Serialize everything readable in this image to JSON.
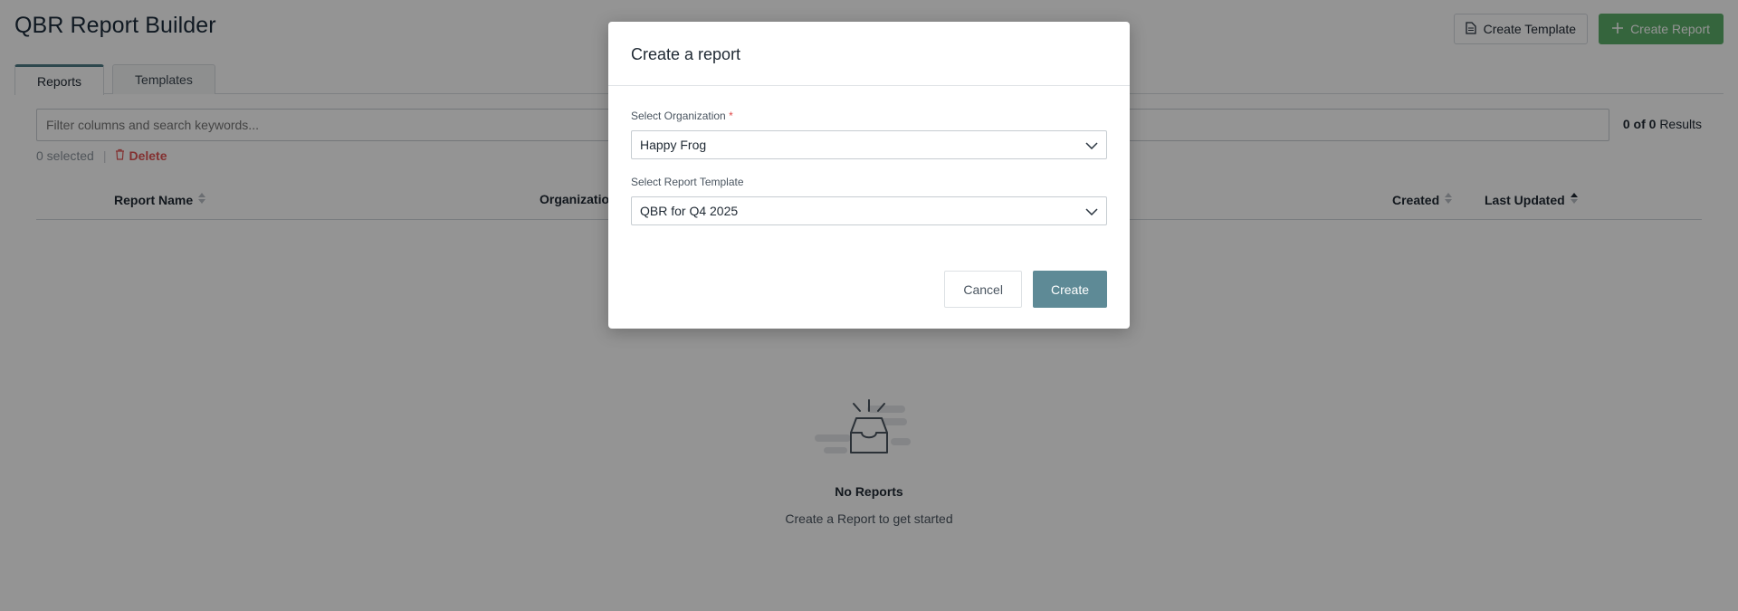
{
  "header": {
    "title": "QBR Report Builder",
    "create_template_label": "Create Template",
    "create_report_label": "Create Report",
    "create_report_icon": "plus-icon",
    "create_template_icon": "document-icon"
  },
  "tabs": [
    {
      "label": "Reports",
      "active": true
    },
    {
      "label": "Templates",
      "active": false
    }
  ],
  "search": {
    "placeholder": "Filter columns and search keywords..."
  },
  "results": {
    "shown": "0",
    "of_label": "of",
    "total": "0",
    "label": "Results"
  },
  "selection": {
    "count_label": "0 selected",
    "delete_label": "Delete"
  },
  "table": {
    "columns": [
      {
        "label": "Report Name",
        "sort": "none"
      },
      {
        "label": "Organization",
        "sort": "none"
      },
      {
        "label": "Created",
        "sort": "none"
      },
      {
        "label": "Last Updated",
        "sort": "asc"
      }
    ]
  },
  "empty_state": {
    "title": "No Reports",
    "subtitle": "Create a Report to get started",
    "icon": "empty-inbox-icon"
  },
  "modal": {
    "title": "Create a report",
    "org_label": "Select Organization",
    "org_required_mark": "*",
    "org_value": "Happy Frog",
    "template_label": "Select Report Template",
    "template_value": "QBR for Q4 2025",
    "cancel_label": "Cancel",
    "create_label": "Create"
  },
  "colors": {
    "accent": "#5e8a96",
    "green": "#5cae6a",
    "danger": "#e25555"
  }
}
